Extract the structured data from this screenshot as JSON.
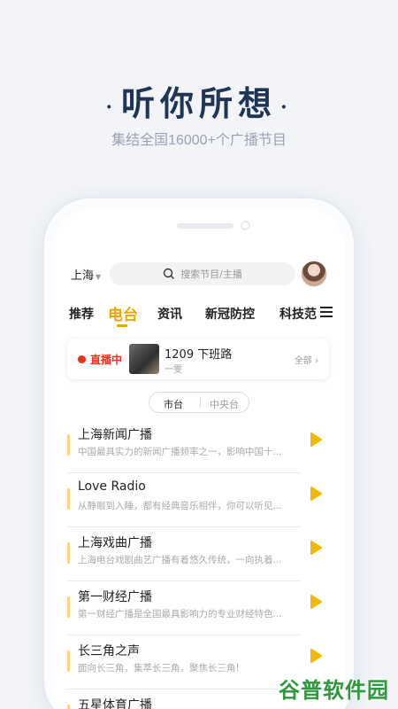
{
  "promo": {
    "headline": "听你所想",
    "headline_dot": "·",
    "subline": "集结全国16000+个广播节目"
  },
  "app": {
    "city": "上海",
    "search_placeholder": "搜索节目/主播",
    "tabs": [
      "推荐",
      "电台",
      "资讯",
      "新冠防控",
      "科技范"
    ],
    "active_tab": "电台",
    "live": {
      "badge": "直播中",
      "title": "1209 下班路",
      "host": "一雯",
      "all_label": "全部 ›"
    },
    "segment": {
      "options": [
        "市台",
        "中央台"
      ],
      "selected": "市台"
    },
    "stations": [
      {
        "name": "上海新闻广播",
        "desc": "中国最具实力的新闻广播频率之一，影响中国十..."
      },
      {
        "name": "Love Radio",
        "desc": "从静眼到入睡，都有经典音乐相伴，你可以听见..."
      },
      {
        "name": "上海戏曲广播",
        "desc": "上海电台戏剧曲艺广播有着悠久传统，一向执着..."
      },
      {
        "name": "第一财经广播",
        "desc": "第一财经广播是全国最具影响力的专业财经特色..."
      },
      {
        "name": "长三角之声",
        "desc": "面向长三角，集萃长三角，聚焦长三角!"
      },
      {
        "name": "五星体育广播",
        "desc": ""
      }
    ]
  },
  "watermark": "谷普软件园",
  "colors": {
    "accent": "#e6a800",
    "live": "#e8331c",
    "headline": "#1f3556",
    "watermark": "#2c9a3c"
  },
  "icons": [
    "search-icon",
    "menu-icon",
    "play-icon",
    "live-dot-icon"
  ]
}
